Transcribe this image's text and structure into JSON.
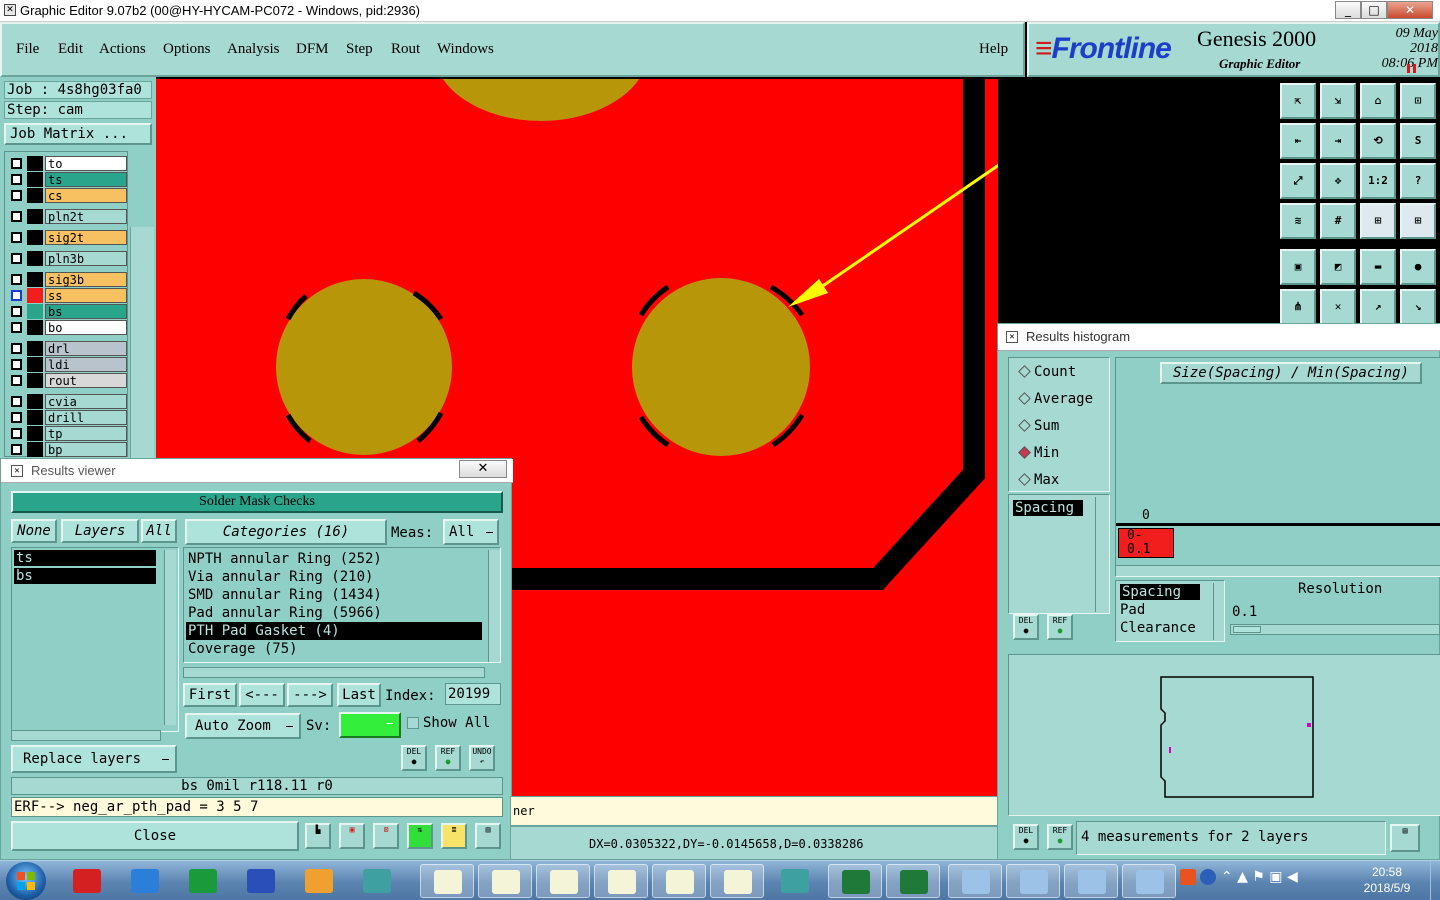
{
  "titlebar": {
    "title": "Graphic Editor 9.07b2 (00@HY-HYCAM-PC072 - Windows, pid:2936)",
    "min": "_",
    "max": "□",
    "close": "✕"
  },
  "menu": {
    "items": [
      "File",
      "Edit",
      "Actions",
      "Options",
      "Analysis",
      "DFM",
      "Step",
      "Rout",
      "Windows"
    ],
    "help": "Help"
  },
  "brand": {
    "logo": "Frontline",
    "product": "Genesis 2000",
    "subtitle": "Graphic Editor",
    "date": "09 May 2018",
    "time": "08:06 PM"
  },
  "left": {
    "job": "Job : 4s8hg03fa0",
    "step": "Step: cam",
    "job_matrix": "Job Matrix ...",
    "layers": [
      {
        "name": "to",
        "color": "#ffffff",
        "selected": false
      },
      {
        "name": "ts",
        "color": "#2aa48a",
        "selected": false
      },
      {
        "name": "cs",
        "color": "#f7c162",
        "selected": false
      },
      {
        "name": "pln2t",
        "color": "#a6d9d2",
        "selected": false
      },
      {
        "name": "sig2t",
        "color": "#f7c162",
        "selected": false
      },
      {
        "name": "pln3b",
        "color": "#a6d9d2",
        "selected": false
      },
      {
        "name": "sig3b",
        "color": "#f7c162",
        "selected": false
      },
      {
        "name": "ss",
        "color": "#f7c162",
        "selected": true
      },
      {
        "name": "bs",
        "color": "#2aa48a",
        "selected": false
      },
      {
        "name": "bo",
        "color": "#ffffff",
        "selected": false
      },
      {
        "name": "drl",
        "color": "#b8c3cc",
        "selected": false
      },
      {
        "name": "ldi",
        "color": "#b8c3cc",
        "selected": false
      },
      {
        "name": "rout",
        "color": "#d8d8d8",
        "selected": false
      },
      {
        "name": "cvia",
        "color": "#a6d9d2",
        "selected": false
      },
      {
        "name": "drill",
        "color": "#a6d9d2",
        "selected": false
      },
      {
        "name": "tp",
        "color": "#a6d9d2",
        "selected": false
      },
      {
        "name": "bp",
        "color": "#a6d9d2",
        "selected": false
      }
    ]
  },
  "tools": [
    "⇱",
    "⇲",
    "⌂",
    "⊡",
    "⇤",
    "⇥",
    "⟲",
    "S",
    "⤢",
    "✥",
    "1:2",
    "?",
    "≋",
    "#",
    "⊞",
    "⊞",
    "▣",
    "◩",
    "▬",
    "●",
    "⋔",
    "✕",
    "↗",
    "↘"
  ],
  "histogram": {
    "title": "Results histogram",
    "modes": [
      {
        "label": "Count",
        "on": false
      },
      {
        "label": "Average",
        "on": false
      },
      {
        "label": "Sum",
        "on": false
      },
      {
        "label": "Min",
        "on": true
      },
      {
        "label": "Max",
        "on": false
      }
    ],
    "heading": "Size(Spacing) / Min(Spacing)",
    "list_item": "Spacing",
    "axis_zero": "0",
    "bar_label": "0-\n0.1",
    "types": [
      "Spacing",
      "Pad",
      "Clearance"
    ],
    "resolution_label": "Resolution",
    "resolution_value": "0.1",
    "footer": "4 measurements for 2 layers",
    "del": "DEL",
    "ref": "REF"
  },
  "viewer": {
    "title": "Results viewer",
    "heading": "Solder Mask Checks",
    "none": "None",
    "layers_btn": "Layers",
    "all": "All",
    "layer_items": [
      "ts",
      "bs"
    ],
    "categories_btn": "Categories (16)",
    "meas_label": "Meas:",
    "meas_value": "All",
    "categories": [
      {
        "text": "NPTH annular Ring (252)",
        "sel": false
      },
      {
        "text": "Via annular Ring (210)",
        "sel": false
      },
      {
        "text": "SMD annular Ring (1434)",
        "sel": false
      },
      {
        "text": "Pad annular Ring (5966)",
        "sel": false
      },
      {
        "text": "PTH Pad Gasket (4)",
        "sel": true
      },
      {
        "text": "Coverage (75)",
        "sel": false
      }
    ],
    "first": "First",
    "prev": "<---",
    "next": "--->",
    "last": "Last",
    "index_label": "Index:",
    "index_value": "20199",
    "auto_zoom": "Auto Zoom",
    "sv_label": "Sv:",
    "show_all": "Show All",
    "replace_layers": "Replace layers",
    "info": "bs 0mil  r118.11  r0",
    "erf": "ERF--> neg_ar_pth_pad = 3 5 7",
    "close": "Close",
    "del": "DEL",
    "ref": "REF",
    "undo": "UNDO"
  },
  "status": {
    "hint": "ner",
    "coords": "DX=0.0305322,DY=-0.0145658,D=0.0338286"
  },
  "taskbar": {
    "time": "20:58",
    "date": "2018/5/9"
  }
}
